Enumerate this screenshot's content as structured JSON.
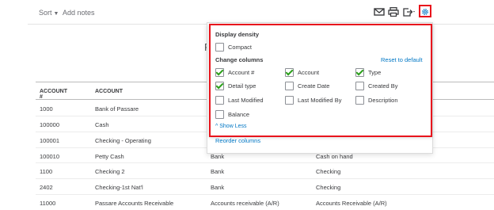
{
  "toolbar": {
    "sort_label": "Sort",
    "add_notes_label": "Add notes",
    "icons": [
      "email-icon",
      "print-icon",
      "export-icon",
      "gear-icon"
    ]
  },
  "report_title_fragment": "F",
  "table": {
    "columns": [
      "ACCOUNT #",
      "ACCOUNT"
    ],
    "rows": [
      {
        "number": "1000",
        "account": "Bank of Passare",
        "type": "",
        "detail": ""
      },
      {
        "number": "100000",
        "account": "Cash",
        "type": "",
        "detail": ""
      },
      {
        "number": "100001",
        "account": "Checking - Operating",
        "type": "",
        "detail": ""
      },
      {
        "number": "100010",
        "account": "Petty Cash",
        "type": "Bank",
        "detail": "Cash on hand"
      },
      {
        "number": "1100",
        "account": "Checking 2",
        "type": "Bank",
        "detail": "Checking"
      },
      {
        "number": "2402",
        "account": "Checking-1st Nat'l",
        "type": "Bank",
        "detail": "Checking"
      },
      {
        "number": "11000",
        "account": "Passare Accounts Receivable",
        "type": "Accounts receivable (A/R)",
        "detail": "Accounts Receivable (A/R)"
      }
    ]
  },
  "settings": {
    "display_density_heading": "Display density",
    "compact_label": "Compact",
    "change_columns_heading": "Change columns",
    "reset_label": "Reset to default",
    "columns": [
      {
        "label": "Account #",
        "checked": true
      },
      {
        "label": "Account",
        "checked": true
      },
      {
        "label": "Type",
        "checked": true
      },
      {
        "label": "Detail type",
        "checked": true
      },
      {
        "label": "Create Date",
        "checked": false
      },
      {
        "label": "Created By",
        "checked": false
      },
      {
        "label": "Last Modified",
        "checked": false
      },
      {
        "label": "Last Modified By",
        "checked": false
      },
      {
        "label": "Description",
        "checked": false
      },
      {
        "label": "Balance",
        "checked": false
      }
    ],
    "show_less_label": "Show Less",
    "reorder_label": "Reorder columns"
  },
  "colors": {
    "accent_link": "#0077c5",
    "check_green": "#2ca01c",
    "highlight_red": "#e8141c"
  }
}
